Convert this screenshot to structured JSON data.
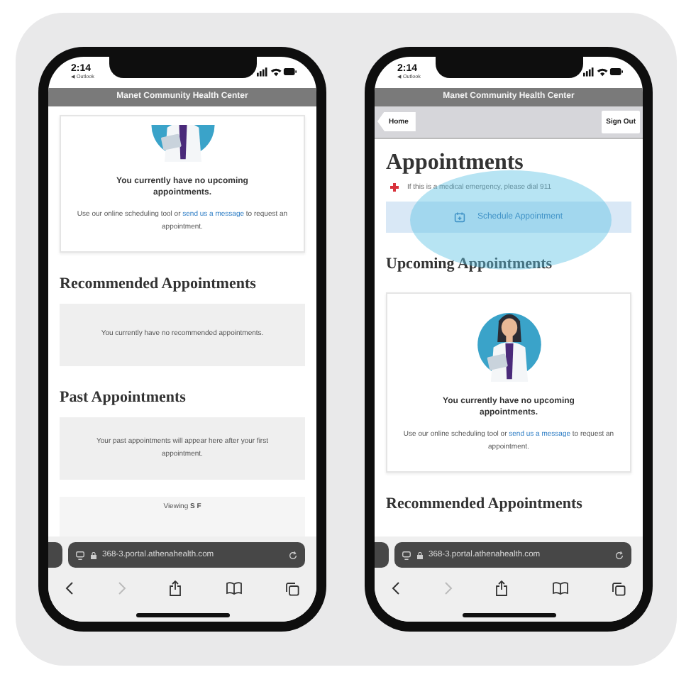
{
  "phones": [
    {
      "time": "2:14",
      "back_app": "◀ Outlook",
      "site_title": "Manet Community Health Center",
      "blocks": [
        {
          "kind": "empty-card",
          "illustration_cut_off": true,
          "title": "You currently have no upcoming appointments.",
          "text_before": "Use our online scheduling tool or",
          "link": "send us a message",
          "text_after": "to request an appointment."
        },
        {
          "kind": "heading",
          "text": "Recommended Appointments"
        },
        {
          "kind": "note",
          "text": "You currently have no recommended appointments."
        },
        {
          "kind": "heading",
          "text": "Past Appointments"
        },
        {
          "kind": "note",
          "text": "Your past appointments will appear here after your first appointment."
        },
        {
          "kind": "viewing",
          "text": "Viewing **S F**"
        }
      ],
      "url": "368-3.portal.athenahealth.com",
      "forward_disabled": true
    },
    {
      "time": "2:14",
      "back_app": "◀ Outlook",
      "site_title": "Manet Community Health Center",
      "nav": {
        "back": "Home",
        "sign_out": "Sign Out"
      },
      "blocks": [
        {
          "kind": "page-title",
          "text": "Appointments"
        },
        {
          "kind": "emergency",
          "text": "If this is a medical emergency, please dial 911"
        },
        {
          "kind": "action",
          "text": "Schedule Appointment",
          "highlighted": true
        },
        {
          "kind": "heading",
          "text": "Upcoming Appointments"
        },
        {
          "kind": "empty-card",
          "illustration_cut_off": false,
          "title": "You currently have no upcoming appointments.",
          "text_before": "Use our online scheduling tool or",
          "link": "send us a message",
          "text_after": "to request an appointment."
        },
        {
          "kind": "heading",
          "text": "Recommended Appointments"
        }
      ],
      "url": "368-3.portal.athenahealth.com",
      "forward_disabled": true
    }
  ]
}
